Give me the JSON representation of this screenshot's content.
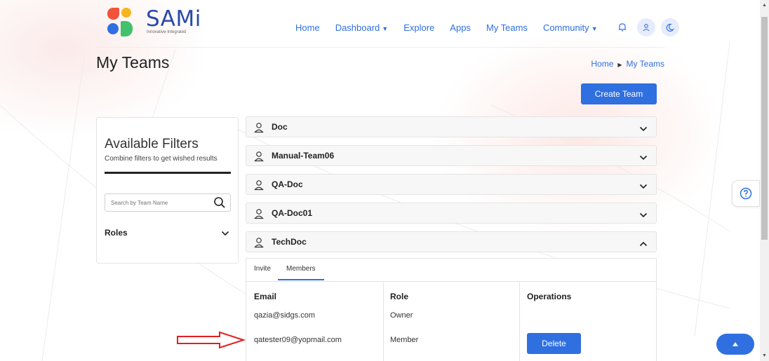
{
  "brand": {
    "name": "SAMi",
    "tagline": "Innovative-Integrated"
  },
  "nav": {
    "home": "Home",
    "dashboard": "Dashboard",
    "explore": "Explore",
    "apps": "Apps",
    "my_teams": "My Teams",
    "community": "Community"
  },
  "page": {
    "title": "My Teams",
    "breadcrumb": {
      "home": "Home",
      "current": "My Teams"
    },
    "create_button": "Create Team"
  },
  "filters": {
    "title": "Available Filters",
    "subtitle": "Combine filters to get wished results",
    "search_placeholder": "Search by Team Name",
    "search_value": "",
    "roles_label": "Roles"
  },
  "teams": [
    {
      "name": "Doc",
      "expanded": false
    },
    {
      "name": "Manual-Team06",
      "expanded": false
    },
    {
      "name": "QA-Doc",
      "expanded": false
    },
    {
      "name": "QA-Doc01",
      "expanded": false
    },
    {
      "name": "TechDoc",
      "expanded": true
    }
  ],
  "team_panel": {
    "tabs": [
      "Invite",
      "Members"
    ],
    "active_tab": "Members",
    "columns": {
      "email": "Email",
      "role": "Role",
      "operations": "Operations"
    },
    "members": [
      {
        "email": "qazia@sidgs.com",
        "role": "Owner",
        "action": ""
      },
      {
        "email": "qatester09@yopmail.com",
        "role": "Member",
        "action": "Delete"
      }
    ]
  },
  "colors": {
    "accent": "#2f6fe0",
    "annotation_arrow": "#e02020"
  }
}
